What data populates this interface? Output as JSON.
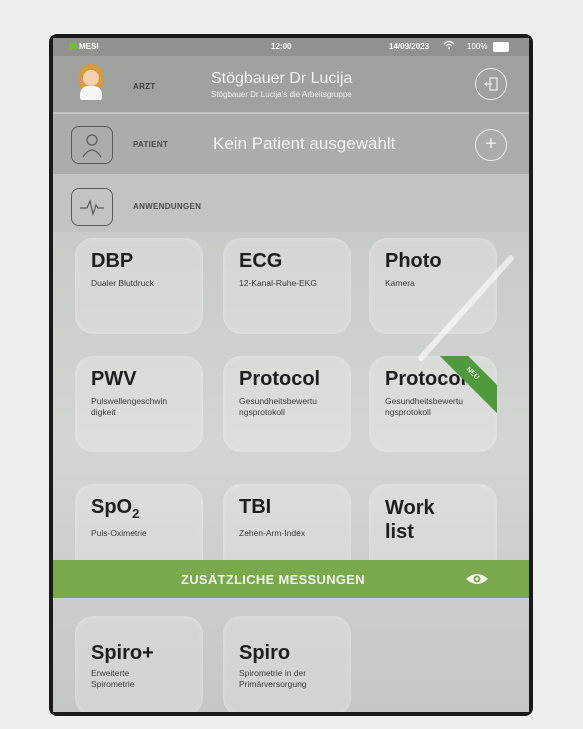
{
  "statusbar": {
    "carrier": "MESI",
    "time": "12:00",
    "date": "14/09/2023",
    "battery": "100%"
  },
  "arzt": {
    "label": "ARZT",
    "name": "Stögbauer Dr Lucija",
    "group": "Stögbauer Dr Lucija's die Arbeitsgruppe"
  },
  "patient": {
    "label": "PATIENT",
    "status": "Kein Patient ausgewählt",
    "add_symbol": "+"
  },
  "anwendungen": {
    "label": "ANWENDUNGEN"
  },
  "tiles": [
    {
      "title": "DBP",
      "sub": "Dualer Blutdruck"
    },
    {
      "title": "ECG",
      "sub": "12-Kanal-Ruhe-EKG"
    },
    {
      "title": "Photo",
      "sub": "Kamera"
    },
    {
      "title": "PWV",
      "sub": "Pulswellengeschwin digkeit"
    },
    {
      "title": "Protocol",
      "sub": "Gesundheitsbewertu ngsprotokoll"
    },
    {
      "title": "Protocol",
      "sub": "Gesundheitsbewertu ngsprotokoll",
      "badge": "NEU"
    },
    {
      "title": "SpO",
      "title_sub": "2",
      "sub": "Puls-Oximetrie"
    },
    {
      "title": "TBI",
      "sub": "Zehen-Arm-Index"
    },
    {
      "title": "Work list",
      "sub": ""
    },
    {
      "title": "Spiro+",
      "sub": "Erweiterte Spirometrie"
    },
    {
      "title": "Spiro",
      "sub": "Spirometrie in der Primärversorgung"
    }
  ],
  "zusaetzlich": {
    "label": "ZUSÄTZLICHE MESSUNGEN"
  },
  "colors": {
    "accent_green": "#7aa84c",
    "badge_green": "#4f9a3c"
  }
}
